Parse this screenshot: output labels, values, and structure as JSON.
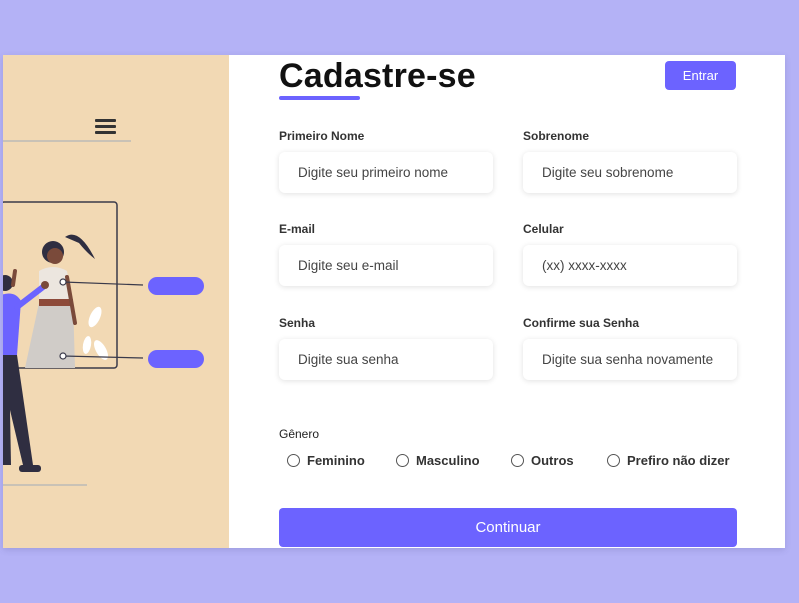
{
  "header": {
    "title": "Cadastre-se",
    "login_label": "Entrar"
  },
  "fields": {
    "first_name": {
      "label": "Primeiro Nome",
      "placeholder": "Digite seu primeiro nome"
    },
    "last_name": {
      "label": "Sobrenome",
      "placeholder": "Digite seu sobrenome"
    },
    "email": {
      "label": "E-mail",
      "placeholder": "Digite seu e-mail"
    },
    "phone": {
      "label": "Celular",
      "placeholder": "(xx) xxxx-xxxx"
    },
    "password": {
      "label": "Senha",
      "placeholder": "Digite sua senha"
    },
    "confirm_password": {
      "label": "Confirme sua Senha",
      "placeholder": "Digite sua senha novamente"
    }
  },
  "gender": {
    "label": "Gênero",
    "options": [
      "Feminino",
      "Masculino",
      "Outros",
      "Prefiro não dizer"
    ]
  },
  "submit_label": "Continuar",
  "colors": {
    "accent": "#6c63ff",
    "background": "#b4b2f6",
    "illustration_bg": "#f2d9b4"
  },
  "icons": {
    "menu": "hamburger-menu-icon"
  }
}
